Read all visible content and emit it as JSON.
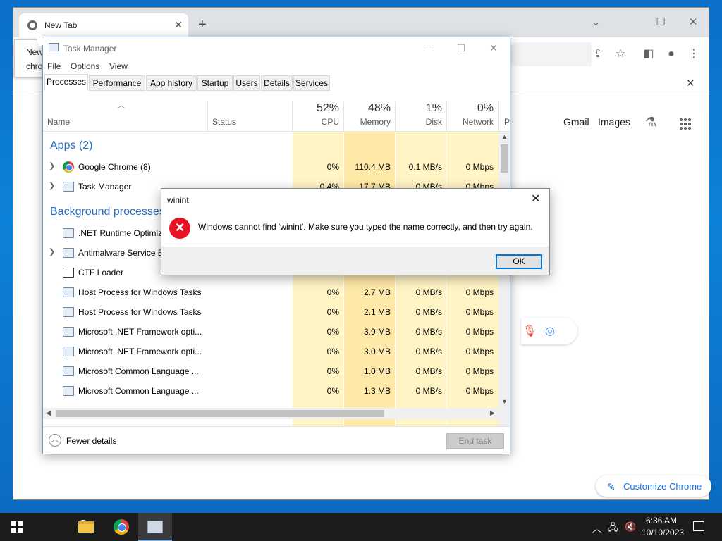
{
  "chrome": {
    "tab_title": "New Tab",
    "tooltip_line1": "New",
    "tooltip_line2": "chro",
    "links": {
      "gmail": "Gmail",
      "images": "Images"
    },
    "customize_label": "Customize Chrome"
  },
  "task_manager": {
    "title": "Task Manager",
    "menu": [
      "File",
      "Options",
      "View"
    ],
    "tabs": [
      "Processes",
      "Performance",
      "App history",
      "Startup",
      "Users",
      "Details",
      "Services"
    ],
    "active_tab": "Processes",
    "columns": {
      "name": "Name",
      "status": "Status",
      "cpu": {
        "pct": "52%",
        "label": "CPU"
      },
      "memory": {
        "pct": "48%",
        "label": "Memory"
      },
      "disk": {
        "pct": "1%",
        "label": "Disk"
      },
      "network": {
        "pct": "0%",
        "label": "Network"
      },
      "power_partial": "P"
    },
    "groups": {
      "apps": "Apps (2)",
      "background": "Background processes"
    },
    "rows": [
      {
        "name": "Google Chrome (8)",
        "cpu": "0%",
        "mem": "110.4 MB",
        "disk": "0.1 MB/s",
        "net": "0 Mbps"
      },
      {
        "name": "Task Manager",
        "cpu": "0.4%",
        "mem": "17.7 MB",
        "disk": "0 MB/s",
        "net": "0 Mbps"
      },
      {
        "name": ".NET Runtime Optimiz",
        "cpu": "",
        "mem": "",
        "disk": "",
        "net": ""
      },
      {
        "name": "Antimalware Service E",
        "cpu": "",
        "mem": "",
        "disk": "",
        "net": ""
      },
      {
        "name": "CTF Loader",
        "cpu": "",
        "mem": "",
        "disk": "",
        "net": ""
      },
      {
        "name": "Host Process for Windows Tasks",
        "cpu": "0%",
        "mem": "2.7 MB",
        "disk": "0 MB/s",
        "net": "0 Mbps"
      },
      {
        "name": "Host Process for Windows Tasks",
        "cpu": "0%",
        "mem": "2.1 MB",
        "disk": "0 MB/s",
        "net": "0 Mbps"
      },
      {
        "name": "Microsoft .NET Framework opti...",
        "cpu": "0%",
        "mem": "3.9 MB",
        "disk": "0 MB/s",
        "net": "0 Mbps"
      },
      {
        "name": "Microsoft .NET Framework opti...",
        "cpu": "0%",
        "mem": "3.0 MB",
        "disk": "0 MB/s",
        "net": "0 Mbps"
      },
      {
        "name": "Microsoft Common Language ...",
        "cpu": "0%",
        "mem": "1.0 MB",
        "disk": "0 MB/s",
        "net": "0 Mbps"
      },
      {
        "name": "Microsoft Common Language ...",
        "cpu": "0%",
        "mem": "1.3 MB",
        "disk": "0 MB/s",
        "net": "0 Mbps"
      }
    ],
    "fewer_details": "Fewer details",
    "end_task": "End task"
  },
  "dialog": {
    "title": "winint",
    "message": "Windows cannot find 'winint'. Make sure you typed the name correctly, and then try again.",
    "ok_label": "OK"
  },
  "taskbar": {
    "time": "6:36 AM",
    "date": "10/10/2023"
  },
  "colors": {
    "accent": "#0078d7",
    "error": "#e81123",
    "group_text": "#2a6cbf",
    "heat_light": "#fff4c4",
    "heat_mem": "#ffe9a8"
  }
}
